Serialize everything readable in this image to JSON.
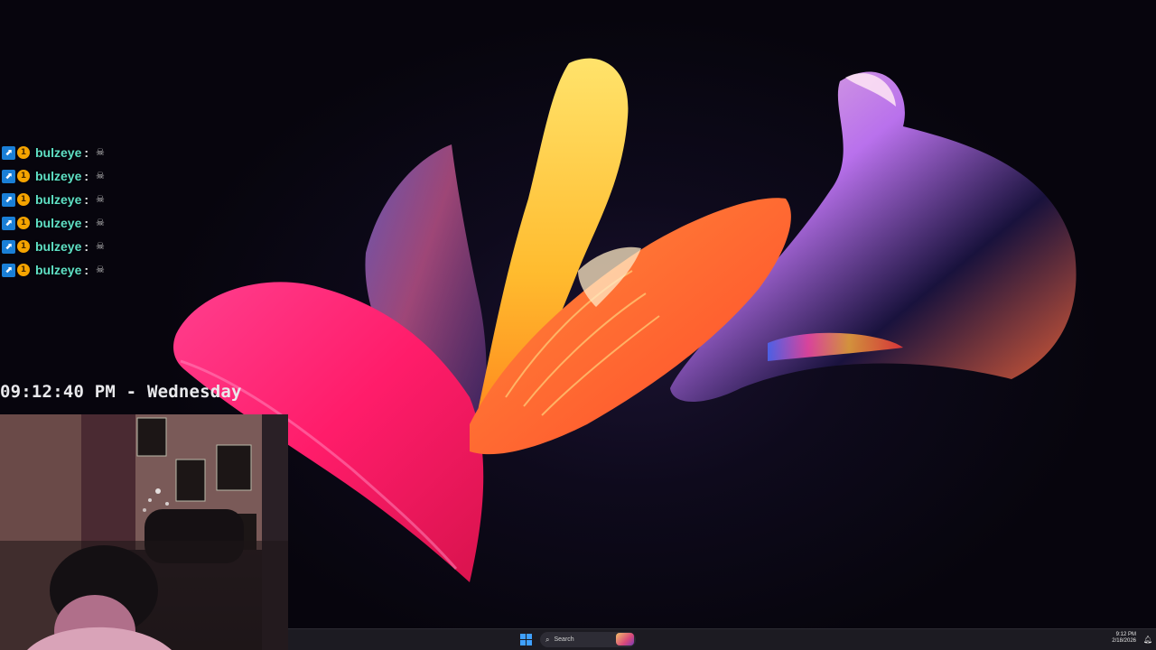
{
  "chat": {
    "messages": [
      {
        "badges": [
          "prime-gaming-icon",
          "sub-badge-icon"
        ],
        "username": "bulzeye",
        "colon": ":",
        "emote": "skull-emote-icon"
      },
      {
        "badges": [
          "prime-gaming-icon",
          "sub-badge-icon"
        ],
        "username": "bulzeye",
        "colon": ":",
        "emote": "skull-emote-icon"
      },
      {
        "badges": [
          "prime-gaming-icon",
          "sub-badge-icon"
        ],
        "username": "bulzeye",
        "colon": ":",
        "emote": "skull-emote-icon"
      },
      {
        "badges": [
          "prime-gaming-icon",
          "sub-badge-icon"
        ],
        "username": "bulzeye",
        "colon": ":",
        "emote": "skull-emote-icon"
      },
      {
        "badges": [
          "prime-gaming-icon",
          "sub-badge-icon"
        ],
        "username": "bulzeye",
        "colon": ":",
        "emote": "skull-emote-icon"
      },
      {
        "badges": [
          "prime-gaming-icon",
          "sub-badge-icon"
        ],
        "username": "bulzeye",
        "colon": ":",
        "emote": "skull-emote-icon"
      }
    ],
    "username_color": "#5fe0c5"
  },
  "overlay": {
    "clock_text": "09:12:40 PM - Wednesday"
  },
  "taskbar": {
    "start_icon": "windows-start-icon",
    "search_placeholder": "Search",
    "search_icon": "search-icon",
    "tray": {
      "time": "9:12 PM",
      "date": "2/18/2026",
      "notification_icon": "notification-bell-icon"
    }
  },
  "colors": {
    "accent": "#3fa0ff",
    "taskbar_bg": "#1c1b22",
    "desktop_bg": "#07050d"
  }
}
